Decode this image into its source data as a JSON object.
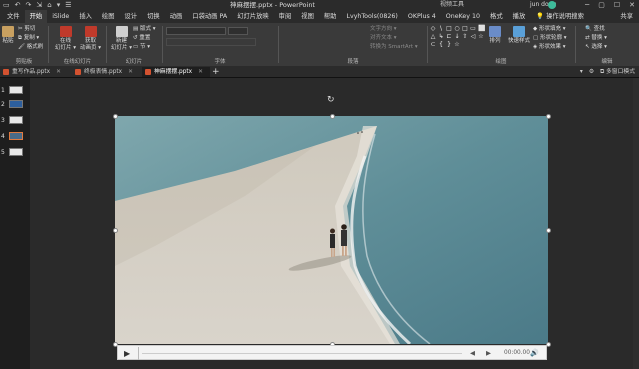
{
  "title_bar": {
    "quick_access": [
      "▭",
      "↶",
      "↷",
      "⇲",
      "⌂",
      "▾",
      "☰"
    ],
    "doc_title": "神麻摆摆.pptx - PowerPoint",
    "context_tool": "视频工具",
    "user": "jun dong",
    "window_controls": [
      "─",
      "▢",
      "☐",
      "✕"
    ]
  },
  "menu": {
    "tabs": [
      "文件",
      "开始",
      "iSlide",
      "插入",
      "绘图",
      "设计",
      "切换",
      "动画",
      "口袋动画 PA",
      "幻灯片放映",
      "审阅",
      "视图",
      "帮助",
      "LvyhTools(0826)",
      "OKPlus 4",
      "OneKey 10",
      "格式",
      "播放"
    ],
    "active_index": 1,
    "tell_me": "操作说明搜索",
    "share": "共享"
  },
  "ribbon": {
    "clipboard": {
      "paste": "粘贴",
      "cut": "剪切",
      "copy": "复制 ▾",
      "format_painter": "格式刷",
      "label": "剪贴板"
    },
    "online_slides": {
      "online": "在线\n幻灯片 ▾",
      "get": "获取\n动画页 ▾",
      "label": "在线幻灯片"
    },
    "slides": {
      "new": "新建\n幻灯片 ▾",
      "layout": "版式 ▾",
      "reset": "重置",
      "section": "节 ▾",
      "label": "幻灯片"
    },
    "font": {
      "label": "字体"
    },
    "paragraph": {
      "label": "段落",
      "text_direction": "文字方向 ▾",
      "align_text": "对齐文本 ▾",
      "smartart": "转换为 SmartArt ▾"
    },
    "drawing": {
      "shapes": [
        "◇",
        "\\",
        "□",
        "○",
        "□",
        "▭",
        "⬜",
        "△",
        "↳",
        "⊏",
        "↓",
        "⇧",
        "◁",
        "☆",
        "⊂",
        "{",
        "}",
        "☆"
      ],
      "arrange": "排列",
      "quick_styles": "快速样式",
      "shape_fill": "形状填充 ▾",
      "shape_outline": "形状轮廓 ▾",
      "shape_effects": "形状效果 ▾",
      "label": "绘图"
    },
    "editing": {
      "find": "查找",
      "replace": "替换 ▾",
      "select": "选择 ▾",
      "label": "编辑"
    }
  },
  "doc_tabs": {
    "tabs": [
      {
        "label": "重写作品.pptx",
        "close": "✕"
      },
      {
        "label": "终极表情.pptx",
        "close": "✕"
      },
      {
        "label": "神麻摆摆.pptx",
        "close": "✕"
      }
    ],
    "active_index": 2,
    "new_tab": "+",
    "right": [
      "▾",
      "⚙",
      "⧉ 多窗口模式"
    ]
  },
  "slides_panel": {
    "thumbs": [
      {
        "num": "1"
      },
      {
        "num": "2"
      },
      {
        "num": "3"
      },
      {
        "num": "4"
      },
      {
        "num": "5"
      }
    ],
    "selected_index": 3
  },
  "video_player": {
    "play": "▶",
    "back": "◀",
    "forward": "▶",
    "time": "00:00.00",
    "volume": "🔊"
  },
  "colors": {
    "accent": "#d35230",
    "ribbon_bg": "#3a3a3a",
    "titlebar_bg": "#2b2b2b",
    "canvas_bg": "#2a2a2a"
  }
}
